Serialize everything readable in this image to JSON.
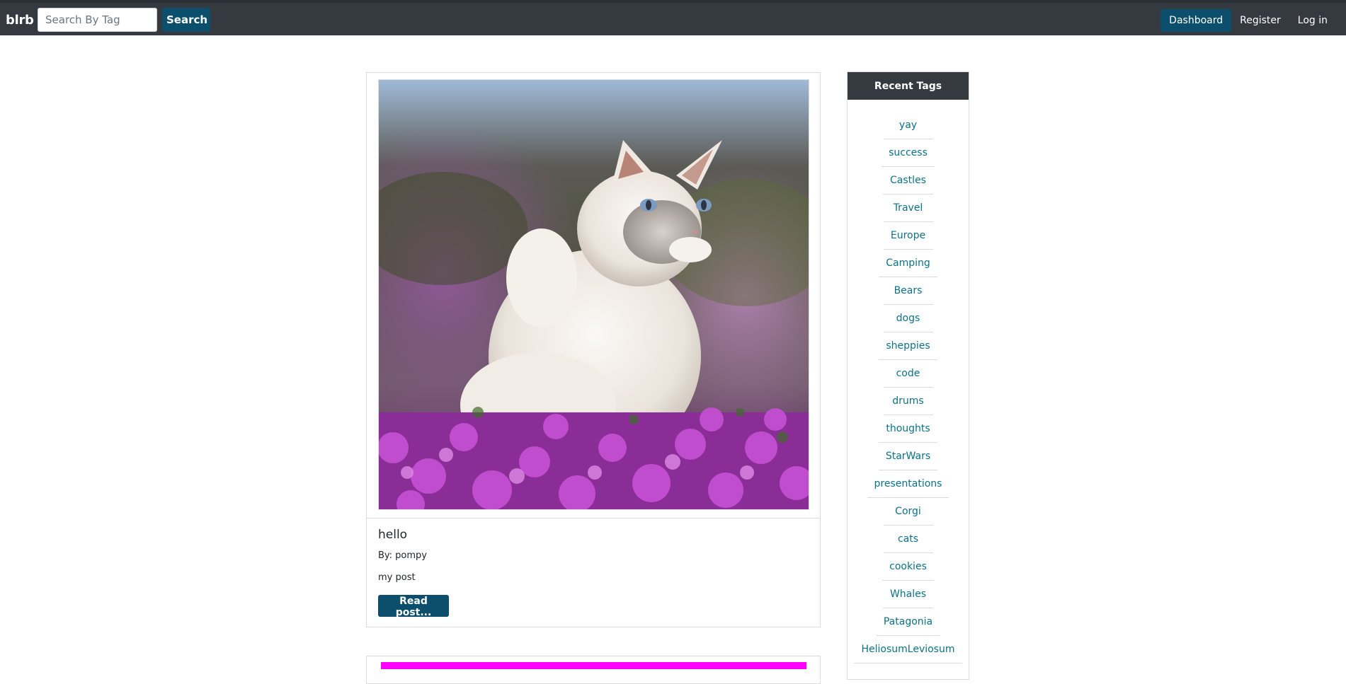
{
  "navbar": {
    "brand": "blrb",
    "search_placeholder": "Search By Tag",
    "search_button": "Search",
    "links": [
      {
        "label": "Dashboard",
        "active": true
      },
      {
        "label": "Register",
        "active": false
      },
      {
        "label": "Log in",
        "active": false
      }
    ]
  },
  "post": {
    "image": "white-fluffy-cat-in-purple-flowers",
    "title": "hello",
    "author": "By: pompy",
    "body": "my post",
    "read_button": "Read post..."
  },
  "sidebar": {
    "title": "Recent Tags",
    "tags": [
      "yay",
      "success",
      "Castles",
      "Travel",
      "Europe",
      "Camping",
      "Bears",
      "dogs",
      "sheppies",
      "code",
      "drums",
      "thoughts",
      "StarWars",
      "presentations",
      "Corgi",
      "cats",
      "cookies",
      "Whales",
      "Patagonia",
      "HeliosumLeviosum"
    ]
  },
  "colors": {
    "navbar_bg": "#343a40",
    "accent": "#0b4f6c",
    "tag_link": "#0b7285",
    "next_post_bar": "#ff00ff"
  }
}
